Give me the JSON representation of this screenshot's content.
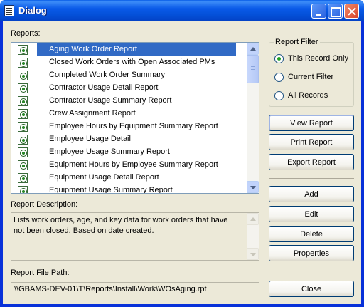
{
  "window": {
    "title": "Dialog"
  },
  "reports": {
    "label": "Reports:",
    "items": [
      "Aging Work Order Report",
      "Closed Work Orders with Open Associated PMs",
      "Completed Work Order Summary",
      "Contractor Usage Detail Report",
      "Contractor Usage Summary Report",
      "Crew Assignment Report",
      "Employee Hours by Equipment Summary Report",
      "Employee Usage Detail",
      "Employee Usage Summary Report",
      "Equipment Hours by Employee Summary Report",
      "Equipment Usage Detail Report",
      "Equipment Usage Summary Report"
    ],
    "selected_index": 0
  },
  "description": {
    "label": "Report Description:",
    "text": "Lists work orders, age, and key data for work orders that have not been closed. Based on date created."
  },
  "file_path": {
    "label": "Report File Path:",
    "value": "\\\\GBAMS-DEV-01\\T\\Reports\\Install\\Work\\WOsAging.rpt"
  },
  "filter": {
    "title": "Report Filter",
    "options": [
      "This Record Only",
      "Current Filter",
      "All Records"
    ],
    "selected": "This Record Only"
  },
  "buttons": {
    "view": "View Report",
    "print": "Print Report",
    "export": "Export Report",
    "add": "Add",
    "edit": "Edit",
    "delete": "Delete",
    "properties": "Properties",
    "close": "Close"
  },
  "colors": {
    "selection": "#316ac5",
    "titlebar": "#0a5ae8",
    "face": "#ece9d8"
  }
}
